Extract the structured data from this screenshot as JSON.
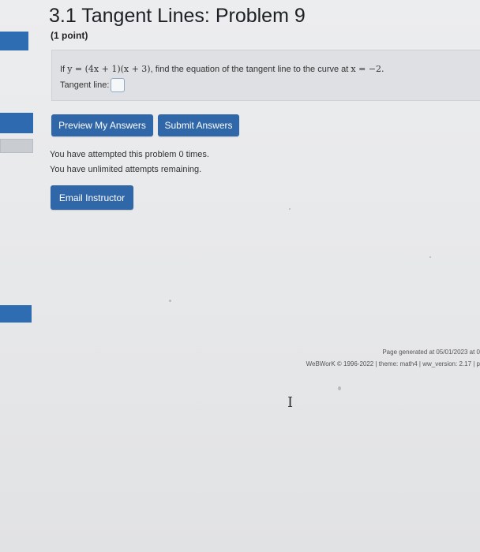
{
  "problem": {
    "title": "3.1 Tangent Lines: Problem 9",
    "points": "(1 point)",
    "statement_prefix": "If",
    "statement_math": "y = (4x + 1)(x + 3)",
    "statement_middle": ", find the equation of the tangent line to the curve at",
    "statement_math2": "x = −2.",
    "answer_label": "Tangent line:",
    "answer_value": ""
  },
  "buttons": {
    "preview": "Preview My Answers",
    "submit": "Submit Answers",
    "email": "Email Instructor"
  },
  "status": {
    "attempts": "You have attempted this problem 0 times.",
    "remaining": "You have unlimited attempts remaining."
  },
  "footer": {
    "generated": "Page generated at 05/01/2023 at 0",
    "copyright": "WeBWorK © 1996-2022 | theme: math4 | ww_version: 2.17 | p"
  },
  "colors": {
    "accent": "#2f67a8",
    "sidebar": "#2f6db3"
  },
  "icons": {
    "cursor": "text-cursor-icon"
  }
}
